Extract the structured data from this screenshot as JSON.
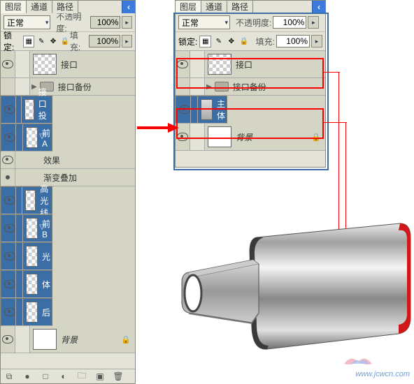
{
  "tabs": {
    "layers": "图层",
    "channels": "通道",
    "paths": "路径"
  },
  "blend_mode": "正常",
  "opacity_lbl": "不透明度:",
  "opacity_val": "100%",
  "lock_lbl": "锁定:",
  "fill_lbl": "填充:",
  "fill_val": "100%",
  "left": {
    "layers": [
      {
        "name": "接口",
        "sel": false,
        "eye": true,
        "thumb": "tr"
      },
      {
        "name": "接口备份",
        "folder": true,
        "sel": false
      },
      {
        "name": "接口投影",
        "sel": true,
        "eye": true,
        "thumb": "tr"
      },
      {
        "name": "前A",
        "sel": true,
        "eye": true,
        "thumb": "tr",
        "fx": true
      },
      {
        "name": "效果",
        "sub": true,
        "eye": true
      },
      {
        "name": "渐变叠加",
        "sub": true,
        "dot": true
      },
      {
        "name": "高光线",
        "sel": true,
        "eye": true,
        "thumb": "tr"
      },
      {
        "name": "前B",
        "sel": true,
        "eye": true,
        "thumb": "tr",
        "fx": true
      },
      {
        "name": "光",
        "sel": true,
        "eye": true,
        "thumb": "tr"
      },
      {
        "name": "体",
        "sel": true,
        "eye": true,
        "thumb": "tr"
      },
      {
        "name": "后",
        "sel": true,
        "eye": true,
        "thumb": "tr"
      },
      {
        "name": "背景",
        "sel": false,
        "eye": true,
        "thumb": "white",
        "italic": true,
        "lock": true
      }
    ]
  },
  "right": {
    "layers": [
      {
        "name": "接口",
        "sel": false,
        "eye": true,
        "thumb": "tr"
      },
      {
        "name": "接口备份",
        "folder": true,
        "sel": false
      },
      {
        "name": "主体",
        "sel": true,
        "eye": true,
        "thumb": "gray"
      },
      {
        "name": "背景",
        "sel": false,
        "eye": true,
        "thumb": "white",
        "italic": true,
        "lock": true
      }
    ]
  },
  "fx_label": "fx",
  "watermark": "www.jcwcn.com"
}
